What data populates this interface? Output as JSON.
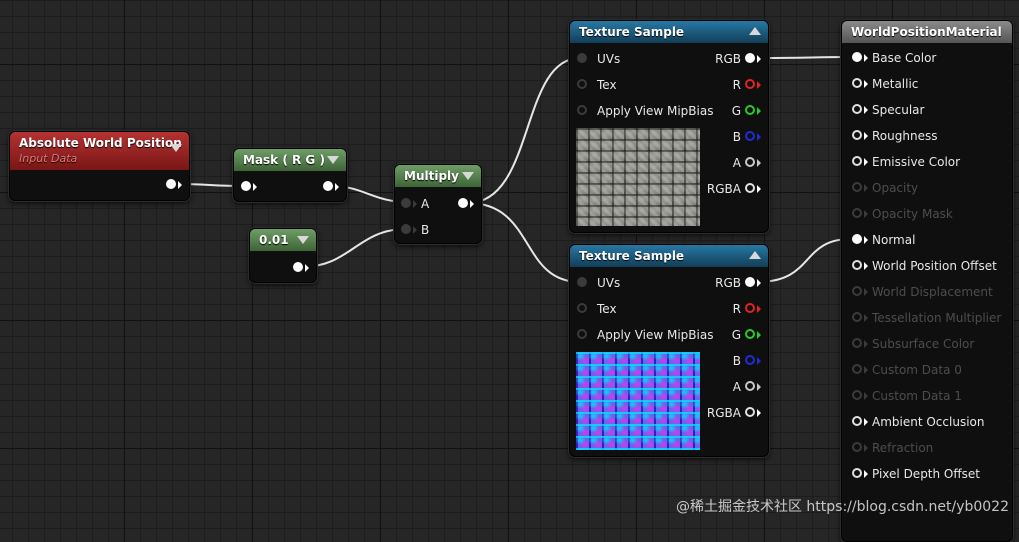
{
  "nodes": {
    "absolute_world_position": {
      "title": "Absolute World Position",
      "subtitle": "Input Data"
    },
    "mask": {
      "title": "Mask ( R G )"
    },
    "constant": {
      "title": "0.01"
    },
    "multiply": {
      "title": "Multiply",
      "input_a": "A",
      "input_b": "B"
    },
    "texture_sample_1": {
      "title": "Texture Sample",
      "inputs": [
        "UVs",
        "Tex",
        "Apply View MipBias"
      ],
      "outputs": [
        "RGB",
        "R",
        "G",
        "B",
        "A",
        "RGBA"
      ]
    },
    "texture_sample_2": {
      "title": "Texture Sample",
      "inputs": [
        "UVs",
        "Tex",
        "Apply View MipBias"
      ],
      "outputs": [
        "RGB",
        "R",
        "G",
        "B",
        "A",
        "RGBA"
      ]
    },
    "material": {
      "title": "WorldPositionMaterial",
      "pins": [
        "Base Color",
        "Metallic",
        "Specular",
        "Roughness",
        "Emissive Color",
        "Opacity",
        "Opacity Mask",
        "Normal",
        "World Position Offset",
        "World Displacement",
        "Tessellation Multiplier",
        "Subsurface Color",
        "Custom Data 0",
        "Custom Data 1",
        "Ambient Occlusion",
        "Refraction",
        "Pixel Depth Offset"
      ]
    }
  },
  "watermark": "@稀土掘金技术社区 https://blog.csdn.net/yb0022",
  "colors": {
    "canvas_bg": "#262626",
    "input_header": "#a12626",
    "math_header": "#5a8a52",
    "texture_header": "#1e5f82",
    "result_header": "#6b6b6b",
    "wire": "#e6e6e6"
  }
}
